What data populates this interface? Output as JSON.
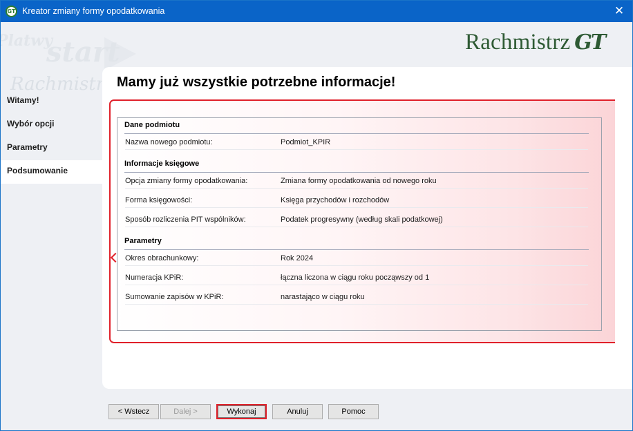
{
  "window": {
    "title": "Kreator zmiany formy opodatkowania",
    "close_glyph": "✕",
    "app_icon": "GT"
  },
  "decoration": {
    "word1": "Platwy",
    "word2": "start",
    "word3": "Rachmistrz"
  },
  "brand": {
    "name": "Rachmistrz",
    "suffix": "GT",
    "color": "#2e5a34"
  },
  "sidebar": {
    "items": [
      {
        "label": "Witamy!"
      },
      {
        "label": "Wybór opcji"
      },
      {
        "label": "Parametry"
      },
      {
        "label": "Podsumowanie"
      }
    ],
    "active_index": 3
  },
  "main": {
    "title": "Mamy już wszystkie potrzebne informacje!",
    "accent_color": "#e0202a",
    "sections": [
      {
        "heading": "Dane podmiotu",
        "rows": [
          {
            "label": "Nazwa nowego podmiotu:",
            "value": "Podmiot_KPIR"
          }
        ]
      },
      {
        "heading": "Informacje księgowe",
        "rows": [
          {
            "label": "Opcja zmiany formy opodatkowania:",
            "value": "Zmiana formy opodatkowania od nowego roku"
          },
          {
            "label": "Forma księgowości:",
            "value": "Księga przychodów i rozchodów"
          },
          {
            "label": "Sposób rozliczenia PIT wspólników:",
            "value": "Podatek progresywny (według skali podatkowej)"
          }
        ]
      },
      {
        "heading": "Parametry",
        "rows": [
          {
            "label": "Okres obrachunkowy:",
            "value": "Rok 2024"
          },
          {
            "label": "Numeracja KPiR:",
            "value": "łączna liczona w ciągu roku począwszy od 1"
          },
          {
            "label": "Sumowanie zapisów w KPiR:",
            "value": "narastająco w ciągu roku"
          }
        ]
      }
    ]
  },
  "buttons": {
    "back": "< Wstecz",
    "next": "Dalej >",
    "execute": "Wykonaj",
    "cancel": "Anuluj",
    "help": "Pomoc"
  }
}
